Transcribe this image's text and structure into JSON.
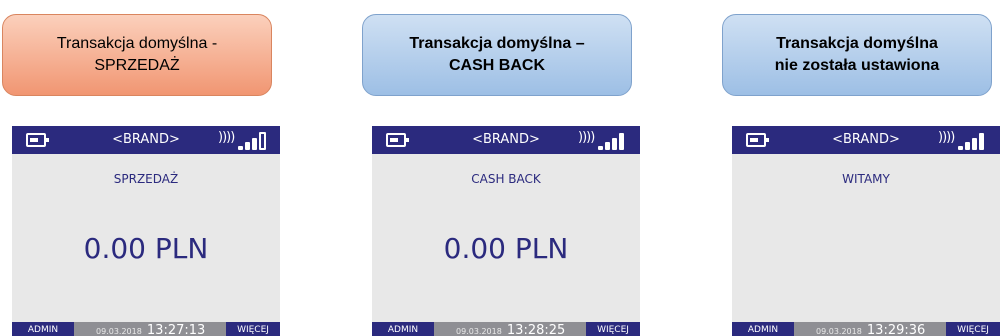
{
  "panels": [
    {
      "callout_line1": "Transakcja domyślna -",
      "callout_line2": "SPRZEDAŻ",
      "brand": "<BRAND>",
      "wifi": "))))",
      "title": "SPRZEDAŻ",
      "amount": "0.00 PLN",
      "left_button": "ADMIN",
      "date": "09.03.2018",
      "time": "13:27:13",
      "right_button": "WIĘCEJ"
    },
    {
      "callout_line1": "Transakcja domyślna –",
      "callout_line2": "CASH BACK",
      "brand": "<BRAND>",
      "wifi": "))))",
      "title": "CASH BACK",
      "amount": "0.00 PLN",
      "left_button": "ADMIN",
      "date": "09.03.2018",
      "time": "13:28:25",
      "right_button": "WIĘCEJ"
    },
    {
      "callout_line1": "Transakcja domyślna",
      "callout_line2": "nie została ustawiona",
      "brand": "<BRAND>",
      "wifi": "))))",
      "title": "WITAMY",
      "amount": "",
      "left_button": "ADMIN",
      "date": "09.03.2018",
      "time": "13:29:36",
      "right_button": "WIĘCEJ"
    }
  ],
  "colors": {
    "status_bar": "#2b2a7e",
    "screen_bg": "#e8e8e8",
    "bottom_bar": "#8f8f94",
    "callout_orange": "#f19672",
    "callout_blue": "#9dbfe5"
  },
  "icons": [
    "battery-icon",
    "wifi-icon",
    "signal-icon"
  ]
}
